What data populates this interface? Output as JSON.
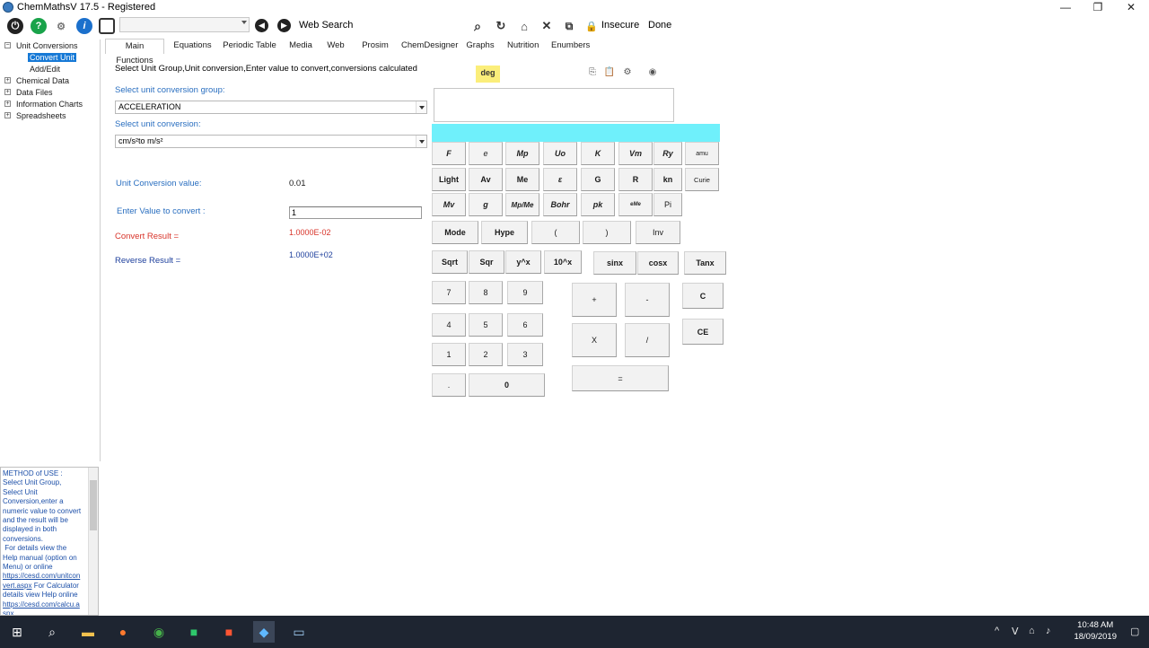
{
  "window": {
    "title": "ChemMathsV 17.5 - Registered",
    "minimize": "—",
    "restore": "❐",
    "close": "✕"
  },
  "toolbar": {
    "combo_value": "",
    "web_search_label": "Web Search",
    "insecure_label": "Insecure",
    "done_label": "Done"
  },
  "tree": {
    "items": [
      {
        "label": "Unit Conversions",
        "expander": "−"
      },
      {
        "label": "Convert Unit"
      },
      {
        "label": "Add/Edit"
      },
      {
        "label": "Chemical Data",
        "expander": "+"
      },
      {
        "label": "Data Files",
        "expander": "+"
      },
      {
        "label": "Information Charts",
        "expander": "+"
      },
      {
        "label": "Spreadsheets",
        "expander": "+"
      }
    ]
  },
  "help": {
    "text": "METHOD of USE :\nSelect Unit Group,\nSelect Unit\nConversion,enter a\nnumeric value to convert\nand the result will be\ndisplayed in both\nconversions.\n For details view the\nHelp manual (option on\nMenu) or online",
    "link1": "https://cesd.com/unitcon\nvert.aspx",
    "text2": " For Calculator\ndetails view Help online",
    "link2": "https://cesd.com/calcu.a\nspx"
  },
  "tabs": [
    "Main Functions",
    "Equations",
    "Periodic Table",
    "Media",
    "Web",
    "Prosim",
    "ChemDesigner",
    "Graphs",
    "Nutrition",
    "Enumbers"
  ],
  "main": {
    "instruction": "Select Unit Group,Unit conversion,Enter value to convert,conversions calculated",
    "group_label": "Select unit conversion group:",
    "group_value": "ACCELERATION",
    "conv_label": "Select unit conversion:",
    "conv_value": "cm/s²to  m/s²",
    "ucv_label": "Unit Conversion value:",
    "ucv_value": "0.01",
    "enter_label": "Enter Value to convert :",
    "enter_value": "1",
    "convert_label": "Convert Result =",
    "convert_value": "1.0000E-02",
    "reverse_label": "Reverse Result =",
    "reverse_value": "1.0000E+02"
  },
  "calculator": {
    "mode_indicator": "deg",
    "display_value": "",
    "row1": [
      "F",
      "e",
      "Mp",
      "Uo",
      "K",
      "Vm",
      "Ry",
      "amu"
    ],
    "row2": [
      "Light",
      "Av",
      "Me",
      "ε",
      "G",
      "R",
      "kn",
      "Curie"
    ],
    "row3": [
      "Mv",
      "g",
      "Mp/Me",
      "Bohr",
      "pk",
      "eMe",
      "Pi"
    ],
    "row4": [
      "Mode",
      "Hype",
      "(",
      ")",
      "Inv"
    ],
    "row5": [
      "Sqrt",
      "Sqr",
      "y^x",
      "10^x",
      "sinx",
      "cosx",
      "Tanx"
    ],
    "digits": [
      "7",
      "8",
      "9",
      "4",
      "5",
      "6",
      "1",
      "2",
      "3",
      ".",
      "0"
    ],
    "ops": [
      "+",
      "-",
      "X",
      "/",
      "="
    ],
    "clear": [
      "C",
      "CE"
    ]
  },
  "taskbar": {
    "time": "10:48 AM",
    "date": "18/09/2019"
  }
}
